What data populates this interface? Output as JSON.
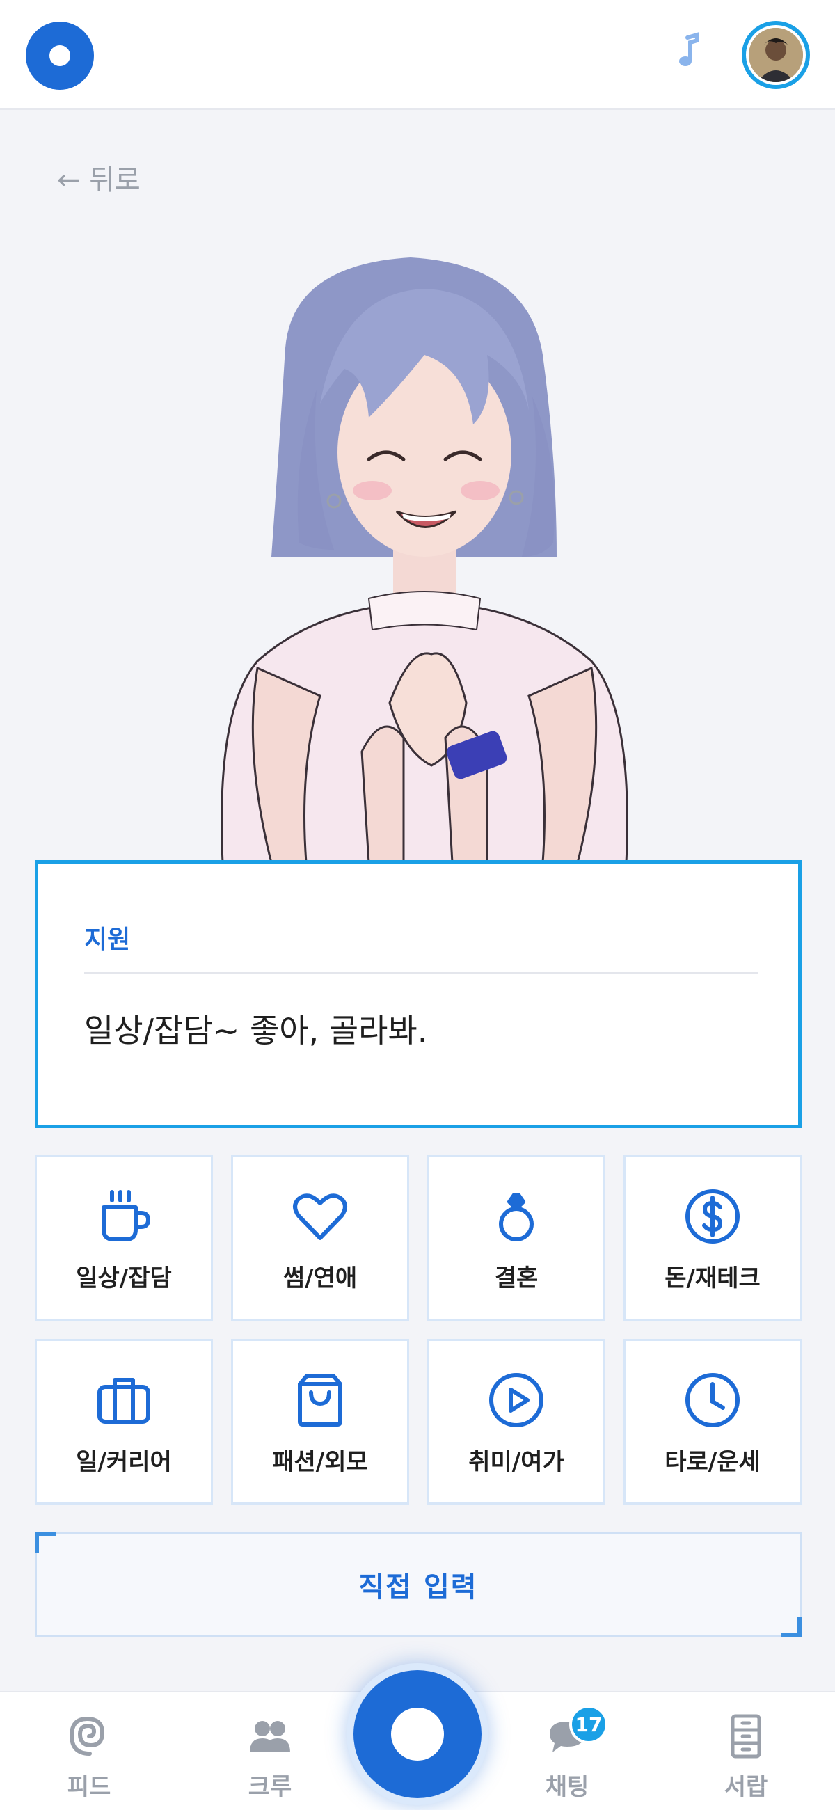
{
  "header": {
    "logo_icon": "circle-logo-icon",
    "music_icon": "music-note-icon",
    "avatar_icon": "user-avatar"
  },
  "back": {
    "label": "← 뒤로"
  },
  "dialog": {
    "speaker": "지원",
    "message": "일상/잡담~ 좋아, 골라봐."
  },
  "categories": [
    {
      "label": "일상/잡담",
      "icon": "coffee-cup-icon"
    },
    {
      "label": "썸/연애",
      "icon": "heart-icon"
    },
    {
      "label": "결혼",
      "icon": "ring-icon"
    },
    {
      "label": "돈/재테크",
      "icon": "dollar-coin-icon"
    },
    {
      "label": "일/커리어",
      "icon": "briefcase-icon"
    },
    {
      "label": "패션/외모",
      "icon": "shopping-bag-icon"
    },
    {
      "label": "취미/여가",
      "icon": "play-circle-icon"
    },
    {
      "label": "타로/운세",
      "icon": "clock-icon"
    }
  ],
  "direct_input": {
    "label": "직접 입력"
  },
  "nav": {
    "items": [
      {
        "label": "피드",
        "icon": "spiral-icon"
      },
      {
        "label": "크루",
        "icon": "people-icon"
      },
      {
        "label": "채팅",
        "icon": "chat-bubble-icon",
        "badge": "17"
      },
      {
        "label": "서랍",
        "icon": "drawer-cabinet-icon"
      }
    ],
    "center_icon": "circle-home-icon"
  },
  "colors": {
    "primary": "#1d6bd6",
    "accent": "#1aa0e6",
    "background": "#f3f4f8",
    "muted": "#9aa0aa"
  }
}
